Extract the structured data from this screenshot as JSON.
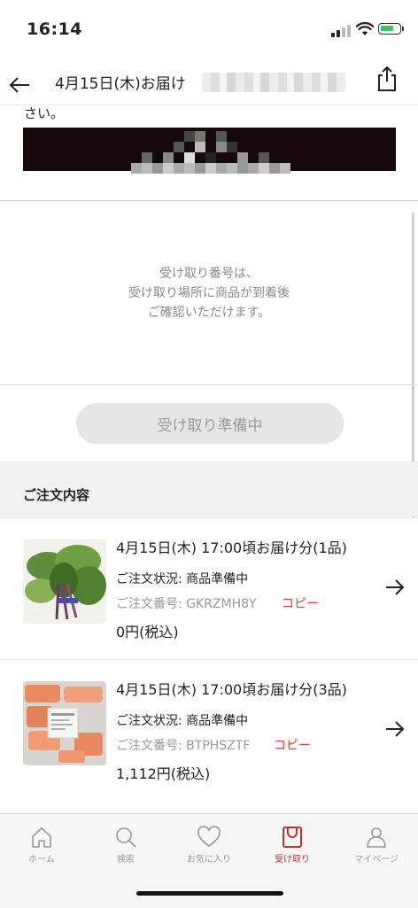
{
  "status_bar": {
    "time": "16:14"
  },
  "header": {
    "title": "4月15日(木)お届け"
  },
  "partial_text": "さい。",
  "pickup_info": {
    "lines": [
      "受け取り番号は、",
      "受け取り場所に商品が到着後",
      "ご確認いただけます。"
    ]
  },
  "pickup_button": {
    "label": "受け取り準備中"
  },
  "order_section": {
    "title": "ご注文内容"
  },
  "orders": [
    {
      "title": "4月15日(木) 17:00頃お届け分(1品)",
      "status": "ご注文状況: 商品準備中",
      "number": "ご注文番号: GKRZMH8Y",
      "copy_label": "コピー",
      "price": "0円(税込)"
    },
    {
      "title": "4月15日(木) 17:00頃お届け分(3品)",
      "status": "ご注文状況: 商品準備中",
      "number": "ご注文番号: BTPHSZTF",
      "copy_label": "コピー",
      "price": "1,112円(税込)"
    }
  ],
  "tabs": [
    {
      "label": "ホーム",
      "icon": "home-icon"
    },
    {
      "label": "検索",
      "icon": "search-icon"
    },
    {
      "label": "お気に入り",
      "icon": "heart-icon"
    },
    {
      "label": "受け取り",
      "icon": "bag-icon",
      "active": true
    },
    {
      "label": "マイページ",
      "icon": "person-icon"
    }
  ],
  "colors": {
    "accent": "#d02a2a",
    "copy_link": "#e03a3a",
    "section_band": "#f0f2f6",
    "redacted_block": "#180a0a"
  }
}
